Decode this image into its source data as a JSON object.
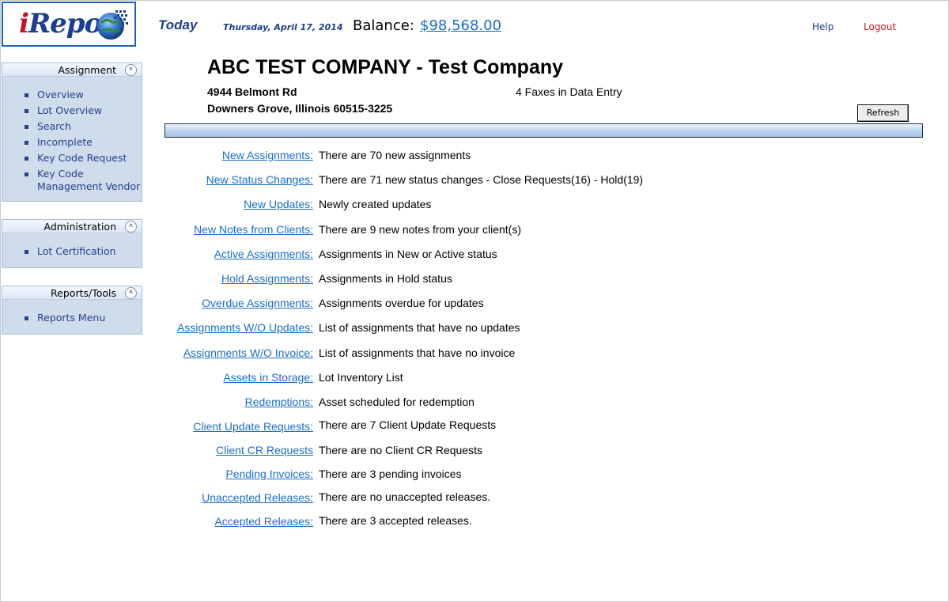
{
  "header": {
    "logo_text": "iRepo",
    "today_label": "Today",
    "date": "Thursday, April 17, 2014",
    "balance_label": "Balance:",
    "balance_value": "$98,568.00",
    "help_label": "Help",
    "logout_label": "Logout"
  },
  "sidebar": {
    "assignment": {
      "title": "Assignment",
      "items": [
        {
          "label": "Overview"
        },
        {
          "label": "Lot Overview"
        },
        {
          "label": "Search"
        },
        {
          "label": "Incomplete"
        },
        {
          "label": "Key Code Request"
        },
        {
          "label": "Key Code Management Vendor"
        }
      ]
    },
    "administration": {
      "title": "Administration",
      "items": [
        {
          "label": "Lot Certification"
        }
      ]
    },
    "reports": {
      "title": "Reports/Tools",
      "items": [
        {
          "label": "Reports Menu"
        }
      ]
    }
  },
  "company": {
    "name": "ABC TEST COMPANY - Test Company",
    "address1": "4944 Belmont Rd",
    "address2": "Downers Grove, Illinois 60515-3225",
    "faxes": "4 Faxes in Data Entry",
    "refresh_label": "Refresh"
  },
  "rows": [
    {
      "link": "New Assignments:",
      "desc": "There are 70 new assignments"
    },
    {
      "link": "New Status Changes:",
      "desc": "There are 71 new status changes - Close Requests(16) - Hold(19)"
    },
    {
      "link": "New Updates:",
      "desc": "Newly created updates"
    },
    {
      "link": "New Notes from Clients:",
      "desc": "There are 9 new notes from your client(s)"
    },
    {
      "link": "Active Assignments:",
      "desc": "Assignments in New or Active status"
    },
    {
      "link": "Hold Assignments:",
      "desc": "Assignments in Hold status"
    },
    {
      "link": "Overdue Assignments:",
      "desc": "Assignments overdue for updates"
    },
    {
      "link": "Assignments W/O Updates:",
      "desc": "List of assignments that have no updates"
    },
    {
      "link": "Assignments W/O Invoice:",
      "desc": "List of assignments that have no invoice"
    },
    {
      "link": "Assets in Storage:",
      "desc": "Lot Inventory List"
    },
    {
      "link": "Redemptions:",
      "desc": "Asset scheduled for redemption"
    },
    {
      "link": "Client Update Requests:",
      "desc": "There are 7 Client Update Requests"
    },
    {
      "link": "Client CR Requests",
      "desc": "There are no Client CR Requests"
    },
    {
      "link": "Pending Invoices:",
      "desc": "There are 3 pending invoices"
    },
    {
      "link": "Unaccepted Releases:",
      "desc": "There are no unaccepted releases."
    },
    {
      "link": "Accepted Releases:",
      "desc": "There are 3 accepted releases."
    }
  ]
}
